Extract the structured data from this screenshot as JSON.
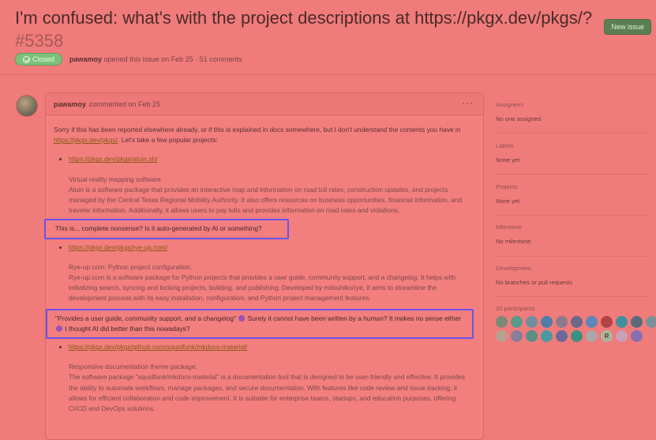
{
  "issue": {
    "title": "I'm confused: what's with the project descriptions at https://pkgx.dev/pkgs/?",
    "number": "#5358",
    "status": "Closed",
    "author": "pawamoy",
    "meta": "opened this issue on Feb 25 · 51 comments",
    "new_issue_label": "New issue"
  },
  "comment": {
    "author": "pawamoy",
    "date": "commented on Feb 25",
    "menu_glyph": "···",
    "intro_before_link": "Sorry if this has been reported elsewhere already, or if this is explained in docs somewhere, but I don't understand the contents you have in ",
    "intro_link": "https://pkgx.dev/pkgs/",
    "intro_after_link": ". Let's take a few popular projects:",
    "projects": [
      {
        "url": "https://pkgx.dev/pkgs/atuin.sh/",
        "quote_title": "Virtual reality mapping software",
        "quote_body": "Atuin is a software package that provides an interactive map and information on road toll rates, construction updates, and projects managed by the Central Texas Regional Mobility Authority. It also offers resources on business opportunities, financial information, and traveler information. Additionally, it allows users to pay tolls and provides information on road rates and violations."
      },
      {
        "url": "https://pkgx.dev/pkgs/rye-up.com/",
        "quote_title": "Rye-up.com: Python project configuration.",
        "quote_body": "Rye-up.com is a software package for Python projects that provides a user guide, community support, and a changelog. It helps with initializing search, syncing and locking projects, building, and publishing. Developed by mitsuhiko/rye, it aims to streamline the development process with its easy installation, configuration, and Python project management features."
      },
      {
        "url": "https://pkgx.dev/pkgs/github.com/squidfunk/mkdocs-material/",
        "quote_title": "Responsive documentation theme package.",
        "quote_body": "The software package \"squidfunk/mkdocs-material\" is a documentation tool that is designed to be user-friendly and effective. It provides the ability to automate workflows, manage packages, and secure documentation. With features like code review and issue tracking, it allows for efficient collaboration and code improvement. It is suitable for enterprise teams, startups, and education purposes, offering CI/CD and DevOps solutions."
      }
    ],
    "highlight1": "This is... complete nonsense? Is it auto-generated by AI or something?",
    "highlight2_a": "\"Provides a user guide, community support, and a changelog\"",
    "highlight2_b": " Surely it cannot have been written by a human? It makes no sense either ",
    "highlight2_c": " I thought AI did better than this nowadays?"
  },
  "sidebar": {
    "assignees": {
      "label": "Assignees",
      "value": "No one assigned"
    },
    "labels": {
      "label": "Labels",
      "value": "None yet"
    },
    "projects": {
      "label": "Projects",
      "value": "None yet"
    },
    "milestone": {
      "label": "Milestone",
      "value": "No milestone"
    },
    "development": {
      "label": "Development",
      "value": "No branches or pull requests"
    },
    "participants": {
      "label": "20 participants",
      "avatar_colors": [
        "#7a8a78",
        "#5a9a8a",
        "#6f8fa0",
        "#4f7fa8",
        "#8a7a8f",
        "#6a6a88",
        "#5f86b8",
        "#b44444",
        "#3f8f9f",
        "#5a6b7a",
        "#7d8f96",
        "#b8a090",
        "#888098",
        "#5a8f86",
        "#4a9aa0",
        "#6a6a9a",
        "#3f8f80",
        "#a8a8a8",
        "#a8b8a0",
        "#c8a0b8",
        "#8a6fb0"
      ],
      "avatar_text": [
        "",
        "",
        "",
        "",
        "",
        "",
        "",
        "",
        "",
        "",
        "",
        "",
        "",
        "",
        "",
        "",
        "",
        "",
        "R",
        "",
        ""
      ]
    }
  },
  "colors": {
    "accent": "#6b52e6",
    "closed_badge": "#7bc17a",
    "new_issue": "#5b7f52",
    "link": "#8a5a10"
  }
}
